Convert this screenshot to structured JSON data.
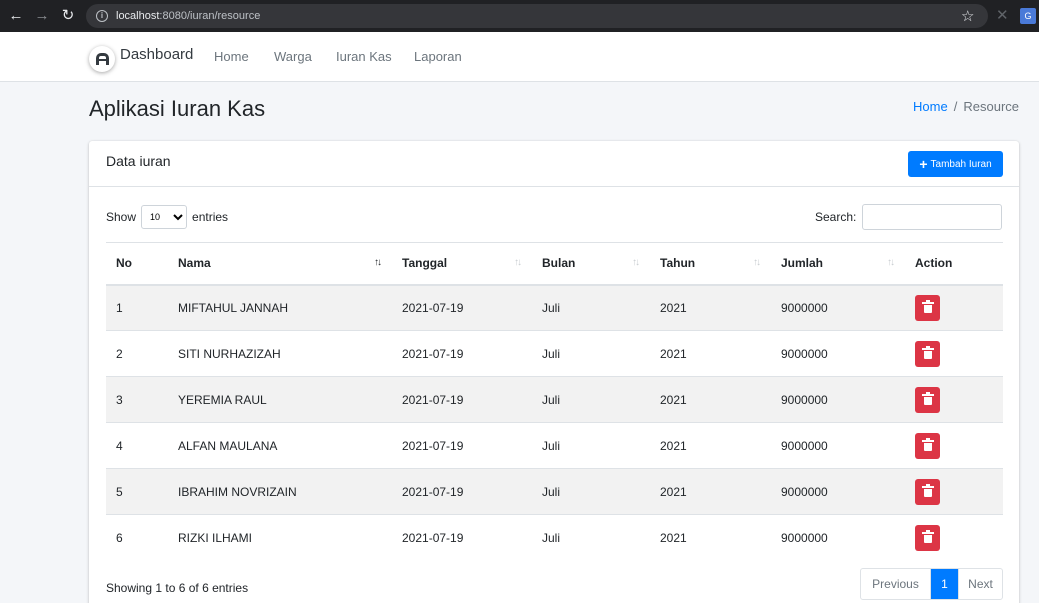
{
  "browser": {
    "url_host": "localhost",
    "url_rest": ":8080/iuran/resource"
  },
  "navbar": {
    "brand": "Dashboard",
    "links": [
      "Home",
      "Warga",
      "Iuran Kas",
      "Laporan"
    ]
  },
  "header": {
    "title": "Aplikasi Iuran Kas",
    "breadcrumb": {
      "home": "Home",
      "separator": "/",
      "current": "Resource"
    }
  },
  "card": {
    "title": "Data iuran",
    "add_button": "Tambah Iuran",
    "show_label": "Show",
    "entries_label": "entries",
    "length_value": "10",
    "search_label": "Search:",
    "search_value": ""
  },
  "table": {
    "columns": [
      "No",
      "Nama",
      "Tanggal",
      "Bulan",
      "Tahun",
      "Jumlah",
      "Action"
    ],
    "sorted_column": "Nama",
    "rows": [
      [
        "1",
        "MIFTAHUL JANNAH",
        "2021-07-19",
        "Juli",
        "2021",
        "9000000"
      ],
      [
        "2",
        "SITI NURHAZIZAH",
        "2021-07-19",
        "Juli",
        "2021",
        "9000000"
      ],
      [
        "3",
        "YEREMIA RAUL",
        "2021-07-19",
        "Juli",
        "2021",
        "9000000"
      ],
      [
        "4",
        "ALFAN MAULANA",
        "2021-07-19",
        "Juli",
        "2021",
        "9000000"
      ],
      [
        "5",
        "IBRAHIM NOVRIZAIN",
        "2021-07-19",
        "Juli",
        "2021",
        "9000000"
      ],
      [
        "6",
        "RIZKI ILHAMI",
        "2021-07-19",
        "Juli",
        "2021",
        "9000000"
      ]
    ]
  },
  "footer": {
    "info": "Showing 1 to 6 of 6 entries",
    "prev": "Previous",
    "page": "1",
    "next": "Next"
  },
  "colors": {
    "primary": "#007bff",
    "danger": "#dc3545"
  }
}
